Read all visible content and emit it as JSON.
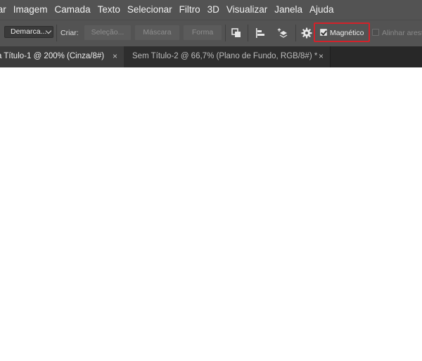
{
  "menu": [
    "tar",
    "Imagem",
    "Camada",
    "Texto",
    "Selecionar",
    "Filtro",
    "3D",
    "Visualizar",
    "Janela",
    "Ajuda"
  ],
  "options": {
    "mode_dropdown": "Demarca...",
    "create_label": "Criar:",
    "buttons": [
      "Seleção...",
      "Máscara",
      "Forma"
    ],
    "icons": [
      "path-operations-icon",
      "path-alignment-icon",
      "path-arrangement-icon",
      "gear-icon"
    ],
    "magnetic_label": "Magnético",
    "magnetic_checked": true,
    "align_edges_label": "Alinhar arestas"
  },
  "tabs": [
    {
      "title": "a Título-1 @ 200% (Cinza/8#)",
      "close": "×",
      "active": true
    },
    {
      "title": "Sem Título-2 @ 66,7% (Plano de Fundo, RGB/8#) *",
      "close": "×",
      "active": false
    }
  ],
  "colors": {
    "chrome": "#535353",
    "tabbar": "#282828",
    "highlight": "#d3222a",
    "canvas": "#ffffff"
  }
}
